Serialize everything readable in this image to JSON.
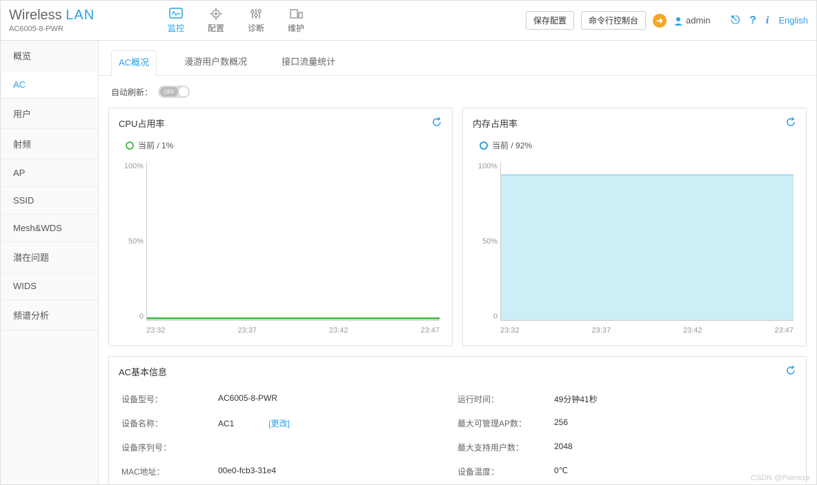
{
  "brand": {
    "word1": "Wireless",
    "word2": "LAN",
    "model": "AC6005-8-PWR"
  },
  "topnav": [
    {
      "label": "监控",
      "active": true
    },
    {
      "label": "配置",
      "active": false
    },
    {
      "label": "诊断",
      "active": false
    },
    {
      "label": "维护",
      "active": false
    }
  ],
  "header": {
    "save": "保存配置",
    "cli": "命令行控制台",
    "user": "admin",
    "lang": "English"
  },
  "sidebar": [
    {
      "label": "概览",
      "active": false
    },
    {
      "label": "AC",
      "active": true
    },
    {
      "label": "用户",
      "active": false
    },
    {
      "label": "射频",
      "active": false
    },
    {
      "label": "AP",
      "active": false
    },
    {
      "label": "SSID",
      "active": false
    },
    {
      "label": "Mesh&WDS",
      "active": false
    },
    {
      "label": "潜在问题",
      "active": false
    },
    {
      "label": "WIDS",
      "active": false
    },
    {
      "label": "频谱分析",
      "active": false
    }
  ],
  "tabs": [
    {
      "label": "AC概况",
      "active": true
    },
    {
      "label": "漫游用户数概况",
      "active": false
    },
    {
      "label": "接口流量统计",
      "active": false
    }
  ],
  "auto_refresh": {
    "label": "自动刷新：",
    "state": "OFF"
  },
  "cpu": {
    "title": "CPU占用率",
    "legend": "当前 / 1%"
  },
  "mem": {
    "title": "内存占用率",
    "legend": "当前 / 92%"
  },
  "info": {
    "title": "AC基本信息",
    "rows": {
      "model_label": "设备型号：",
      "model_val": "AC6005-8-PWR",
      "uptime_label": "运行时间：",
      "uptime_val": "49分钟41秒",
      "name_label": "设备名称：",
      "name_val": "AC1",
      "change": "[更改]",
      "maxap_label": "最大可管理AP数：",
      "maxap_val": "256",
      "sn_label": "设备序列号：",
      "sn_val": "",
      "maxuser_label": "最大支持用户数：",
      "maxuser_val": "2048",
      "mac_label": "MAC地址：",
      "mac_val": "00e0-fcb3-31e4",
      "temp_label": "设备温度：",
      "temp_val": "0℃"
    }
  },
  "chart_data": [
    {
      "type": "line",
      "title": "CPU占用率",
      "ylabel": "%",
      "ylim": [
        0,
        100
      ],
      "yticks": [
        "100%",
        "50%",
        "0"
      ],
      "x": [
        "23:32",
        "23:37",
        "23:42",
        "23:47"
      ],
      "series": [
        {
          "name": "当前",
          "values": [
            1,
            1,
            1,
            1
          ]
        }
      ]
    },
    {
      "type": "area",
      "title": "内存占用率",
      "ylabel": "%",
      "ylim": [
        0,
        100
      ],
      "yticks": [
        "100%",
        "50%",
        "0"
      ],
      "x": [
        "23:32",
        "23:37",
        "23:42",
        "23:47"
      ],
      "series": [
        {
          "name": "当前",
          "values": [
            92,
            92,
            92,
            92
          ]
        }
      ]
    }
  ],
  "watermark": "CSDN @Pierreze"
}
